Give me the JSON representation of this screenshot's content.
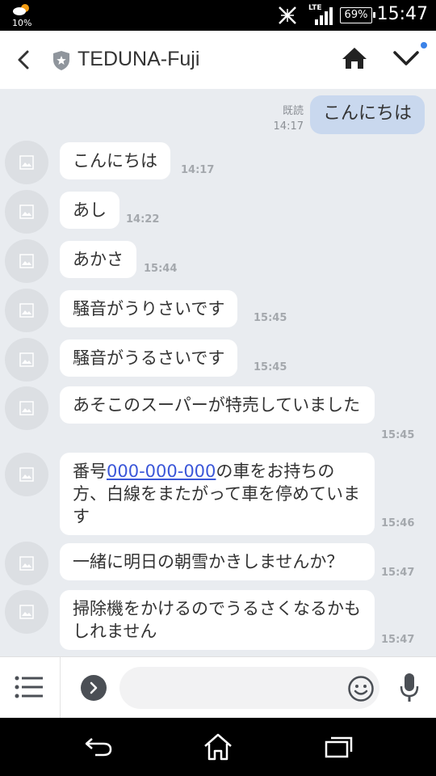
{
  "status": {
    "weather_percent": "10%",
    "network": "LTE",
    "battery": "69%",
    "time": "15:47"
  },
  "header": {
    "title": "TEDUNA-Fuji"
  },
  "chat": {
    "sent": {
      "text": "こんにちは",
      "read": "既読",
      "time": "14:17"
    },
    "received": [
      {
        "text": "こんにちは",
        "time": "14:17"
      },
      {
        "text": "あし",
        "time": "14:22"
      },
      {
        "text": "あかさ",
        "time": "15:44"
      },
      {
        "text": "騒音がうりさいです",
        "time": "15:45"
      },
      {
        "text": "騒音がうるさいです",
        "time": "15:45"
      },
      {
        "text": "あそこのスーパーが特売していました",
        "time": "15:45"
      },
      {
        "text_link": "000-000-000",
        "text_after": "の車をお持ちの方、白線をまたがって車を停めています",
        "text_before": "番号",
        "time": "15:46"
      },
      {
        "text": "一緒に明日の朝雪かきしませんか？",
        "time": "15:47"
      },
      {
        "text": "掃除機をかけるのでうるさくなるかもしれません",
        "time": "15:47"
      }
    ]
  },
  "input": {
    "placeholder": ""
  },
  "icons": {
    "accent": "#3b82e8",
    "sent_bubble": "#c9d8ee",
    "chat_background": "#e9ecf0"
  }
}
